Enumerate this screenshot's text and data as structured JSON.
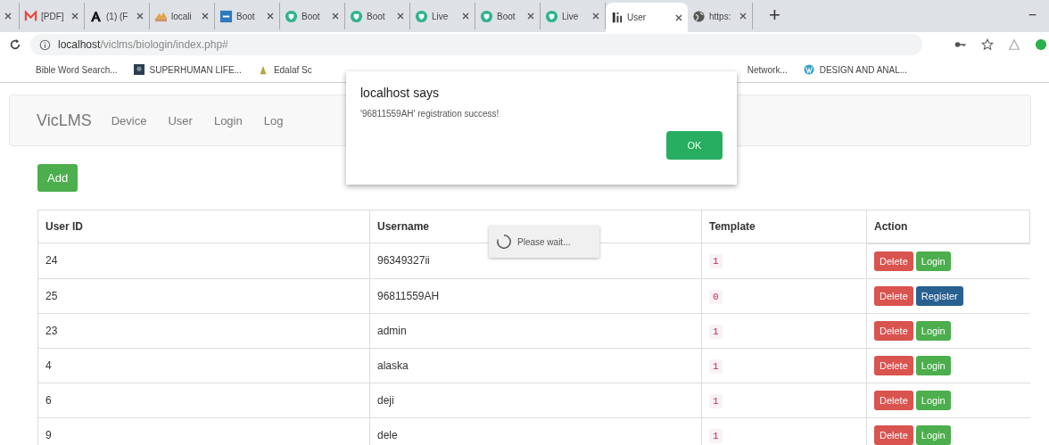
{
  "browser": {
    "tabs": [
      {
        "kind": "partial",
        "selected": false
      },
      {
        "kind": "mail",
        "title": "[PDF]",
        "selected": false
      },
      {
        "kind": "letter",
        "title": "(1) (F",
        "selected": false
      },
      {
        "kind": "image",
        "title": "locali",
        "selected": false
      },
      {
        "kind": "square",
        "title": "Boot",
        "selected": false
      },
      {
        "kind": "hex",
        "title": "Boot",
        "selected": false
      },
      {
        "kind": "hex",
        "title": "Boot",
        "selected": false
      },
      {
        "kind": "hex",
        "title": "Live",
        "selected": false
      },
      {
        "kind": "hex",
        "title": "Boot",
        "selected": false
      },
      {
        "kind": "hex",
        "title": "Live",
        "selected": false
      },
      {
        "kind": "fi",
        "title": "User",
        "selected": true
      },
      {
        "kind": "globe",
        "title": "https:",
        "selected": false
      }
    ],
    "new_tab": "+",
    "minimize": "−",
    "address": {
      "host": "localhost",
      "path": "/viclms/biologin/index.php#"
    },
    "bookmarks_left": [
      "Bible Word Search...",
      "SUPERHUMAN LIFE...",
      "Edalaf Sc"
    ],
    "bookmarks_right": [
      "Network...",
      "DESIGN AND ANAL..."
    ]
  },
  "navbar": {
    "brand": "VicLMS",
    "links": [
      "Device",
      "User",
      "Login",
      "Log"
    ]
  },
  "add_button": "Add",
  "table": {
    "columns": [
      "User ID",
      "Username",
      "Template",
      "Action"
    ],
    "rows": [
      {
        "id": "24",
        "username": "96349327ii",
        "template": "1",
        "actions": [
          {
            "kind": "danger",
            "label": "Delete"
          },
          {
            "kind": "success",
            "label": "Login"
          }
        ]
      },
      {
        "id": "25",
        "username": "96811559AH",
        "template": "0",
        "actions": [
          {
            "kind": "danger",
            "label": "Delete"
          },
          {
            "kind": "primary",
            "label": "Register"
          }
        ]
      },
      {
        "id": "23",
        "username": "admin",
        "template": "1",
        "actions": [
          {
            "kind": "danger",
            "label": "Delete"
          },
          {
            "kind": "success",
            "label": "Login"
          }
        ]
      },
      {
        "id": "4",
        "username": "alaska",
        "template": "1",
        "actions": [
          {
            "kind": "danger",
            "label": "Delete"
          },
          {
            "kind": "success",
            "label": "Login"
          }
        ]
      },
      {
        "id": "6",
        "username": "deji",
        "template": "1",
        "actions": [
          {
            "kind": "danger",
            "label": "Delete"
          },
          {
            "kind": "success",
            "label": "Login"
          }
        ]
      },
      {
        "id": "9",
        "username": "dele",
        "template": "1",
        "actions": [
          {
            "kind": "danger",
            "label": "Delete"
          },
          {
            "kind": "success",
            "label": "Login"
          }
        ]
      }
    ]
  },
  "loading": {
    "text": "Please wait..."
  },
  "alert": {
    "title": "localhost says",
    "message": "'96811559AH' registration success!",
    "button": "OK"
  }
}
